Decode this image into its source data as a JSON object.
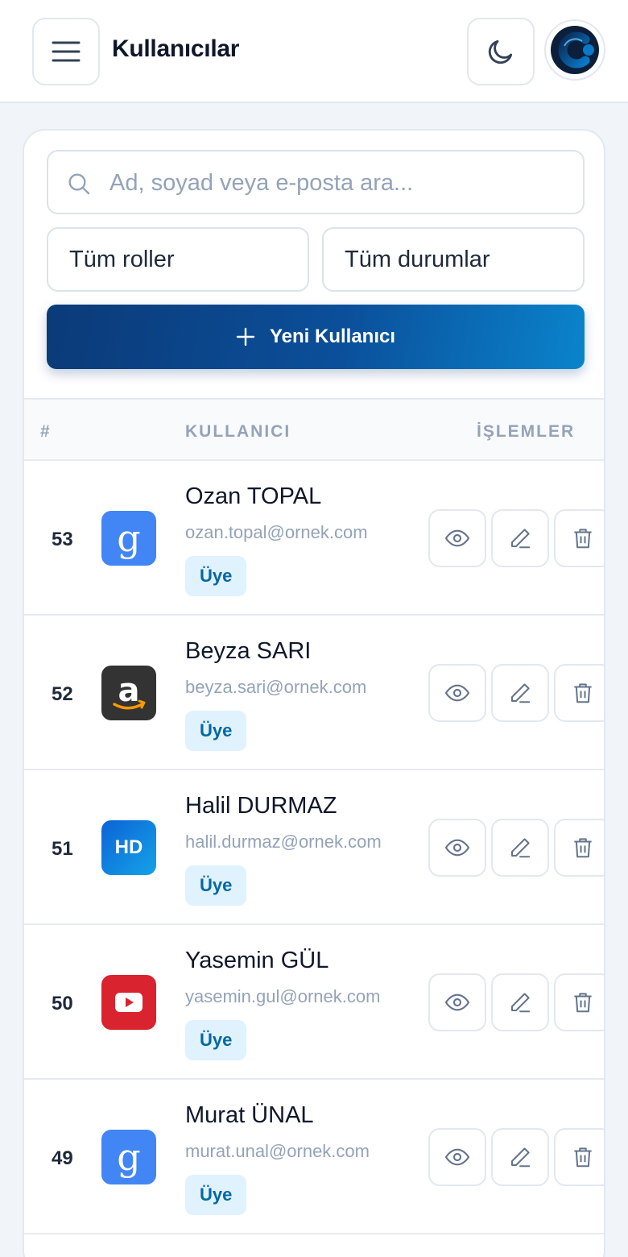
{
  "header": {
    "title": "Kullanıcılar"
  },
  "filters": {
    "search_placeholder": "Ad, soyad veya e-posta ara...",
    "search_value": "",
    "role_select": "Tüm roller",
    "status_select": "Tüm durumlar",
    "new_user_label": "Yeni Kullanıcı"
  },
  "table": {
    "headers": {
      "number": "#",
      "user": "KULLANICI",
      "actions": "İŞLEMLER"
    },
    "rows": [
      {
        "id": "53",
        "name": "Ozan TOPAL",
        "email": "ozan.topal@ornek.com",
        "role": "Üye",
        "avatar": "google-icon"
      },
      {
        "id": "52",
        "name": "Beyza SARI",
        "email": "beyza.sari@ornek.com",
        "role": "Üye",
        "avatar": "amazon-icon"
      },
      {
        "id": "51",
        "name": "Halil DURMAZ",
        "email": "halil.durmaz@ornek.com",
        "role": "Üye",
        "avatar_text": "HD"
      },
      {
        "id": "50",
        "name": "Yasemin GÜL",
        "email": "yasemin.gul@ornek.com",
        "role": "Üye",
        "avatar": "youtube-icon"
      },
      {
        "id": "49",
        "name": "Murat ÜNAL",
        "email": "murat.unal@ornek.com",
        "role": "Üye",
        "avatar": "google-icon"
      }
    ]
  },
  "colors": {
    "primary_gradient_start": "#0b3a78",
    "primary_gradient_end": "#0a84cc",
    "badge_bg": "#e0f2fe",
    "badge_text": "#0369a1"
  }
}
